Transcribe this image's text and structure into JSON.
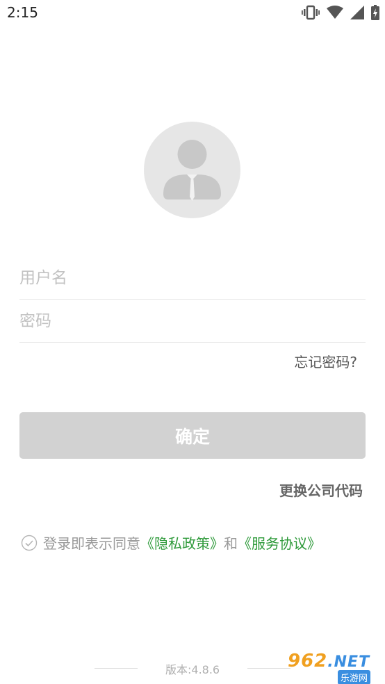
{
  "status_bar": {
    "time": "2:15",
    "icons": [
      "vibrate-icon",
      "wifi-icon",
      "signal-icon",
      "battery-charging-icon"
    ]
  },
  "login": {
    "avatar_icon": "user-avatar-icon",
    "username_placeholder": "用户名",
    "password_placeholder": "密码",
    "forgot_label": "忘记密码?",
    "confirm_label": "确定",
    "change_code_label": "更换公司代码"
  },
  "agreement": {
    "check_icon": "check-circle-icon",
    "prefix": "登录即表示同意",
    "privacy": "《隐私政策》",
    "and": "和",
    "service": "《服务协议》"
  },
  "footer": {
    "version": "版本:4.8.6"
  },
  "watermark": {
    "main": "962",
    "net": ".NET",
    "sub": "乐游网"
  },
  "colors": {
    "link": "#2e9a3a",
    "button_bg": "#d2d2d2",
    "avatar_bg": "#e6e6e6"
  }
}
